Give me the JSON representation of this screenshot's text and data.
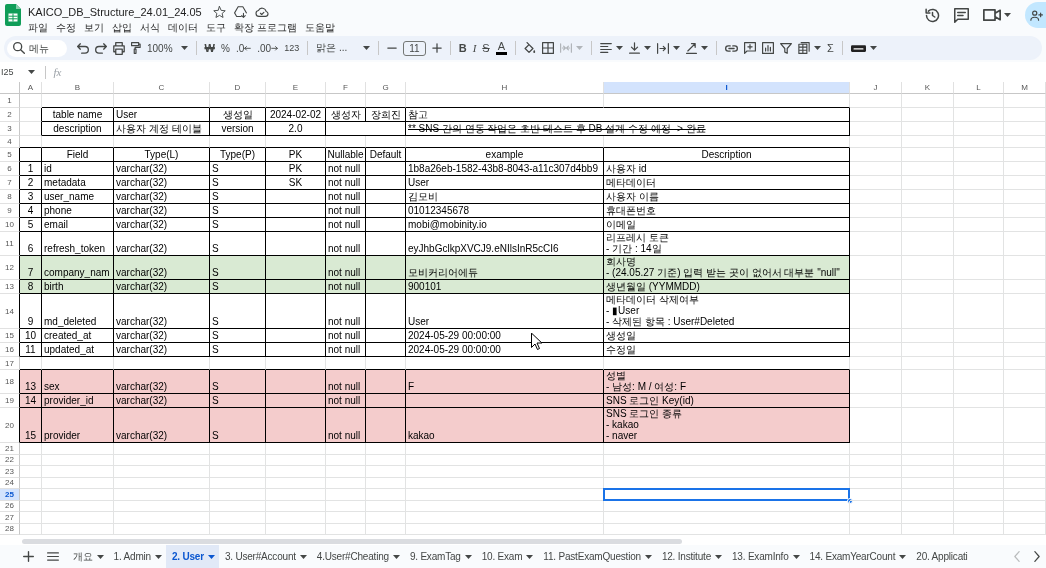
{
  "document": {
    "title": "KAICO_DB_Structure_24.01_24.05"
  },
  "menu_bar": [
    "파일",
    "수정",
    "보기",
    "삽입",
    "서식",
    "데이터",
    "도구",
    "확장 프로그램",
    "도움말"
  ],
  "toolbar": {
    "search": {
      "placeholder": "메뉴"
    },
    "zoom": "100%",
    "currency": "₩",
    "percent": "%",
    "decrease_decimal": ".0",
    "increase_decimal": ".00",
    "number_format": "123",
    "font": "맑은 ...",
    "font_size": "11",
    "bold": "B",
    "italic": "I",
    "strikethrough": "S",
    "text_color": "A",
    "merge_cells": {
      "disabled": true
    },
    "functions": "Σ"
  },
  "formula_bar": {
    "name_box": "I25",
    "fx": "fx"
  },
  "column_headers": [
    {
      "label": "A",
      "selected": false
    },
    {
      "label": "B",
      "selected": false
    },
    {
      "label": "C",
      "selected": false
    },
    {
      "label": "D",
      "selected": false
    },
    {
      "label": "E",
      "selected": false
    },
    {
      "label": "F",
      "selected": false
    },
    {
      "label": "G",
      "selected": false
    },
    {
      "label": "H",
      "selected": false
    },
    {
      "label": "I",
      "selected": true
    },
    {
      "label": "J",
      "selected": false
    },
    {
      "label": "K",
      "selected": false
    },
    {
      "label": "L",
      "selected": false
    },
    {
      "label": "M",
      "selected": false
    }
  ],
  "row_headers": [
    {
      "label": "1",
      "selected": false
    },
    {
      "label": "2",
      "selected": false
    },
    {
      "label": "3",
      "selected": false
    },
    {
      "label": "4",
      "selected": false
    },
    {
      "label": "5",
      "selected": false
    },
    {
      "label": "6",
      "selected": false
    },
    {
      "label": "7",
      "selected": false
    },
    {
      "label": "8",
      "selected": false
    },
    {
      "label": "9",
      "selected": false
    },
    {
      "label": "10",
      "selected": false
    },
    {
      "label": "11",
      "selected": false
    },
    {
      "label": "12",
      "selected": false
    },
    {
      "label": "13",
      "selected": false
    },
    {
      "label": "14",
      "selected": false
    },
    {
      "label": "15",
      "selected": false
    },
    {
      "label": "16",
      "selected": false
    },
    {
      "label": "17",
      "selected": false
    },
    {
      "label": "18",
      "selected": false
    },
    {
      "label": "19",
      "selected": false
    },
    {
      "label": "20",
      "selected": false
    },
    {
      "label": "21",
      "selected": false
    },
    {
      "label": "22",
      "selected": false
    },
    {
      "label": "23",
      "selected": false
    },
    {
      "label": "24",
      "selected": false
    },
    {
      "label": "25",
      "selected": true
    },
    {
      "label": "26",
      "selected": false
    },
    {
      "label": "27",
      "selected": false
    },
    {
      "label": "28",
      "selected": false
    }
  ],
  "info_table": {
    "table_name_label": "table name",
    "table_name": "User",
    "created_label": "생성일",
    "created_date": "2024-02-02",
    "author_label": "생성자",
    "author": "장희진",
    "note_label": "참고",
    "description_label": "description",
    "description": "사용자 계정 테이블",
    "version_label": "version",
    "version": "2.0",
    "note": "** SNS 간의 연동 작업은 초반 테스트 후 DB 설계 수정 예정 -> 완료",
    "note_struck_through": true
  },
  "fields_table": {
    "columns": [
      "Field",
      "Type(L)",
      "Type(P)",
      "PK",
      "Nullable",
      "Default",
      "example",
      "Description"
    ],
    "groups": [
      {
        "rows": [
          {
            "no": "1",
            "field": "id",
            "type_l": "varchar(32)",
            "type_p": "S",
            "pk": "PK",
            "nullable": "not null",
            "example": "1b8a26eb-1582-43b8-8043-a11c307d4bb9",
            "description": "사용자 id"
          },
          {
            "no": "2",
            "field": "metadata",
            "type_l": "varchar(32)",
            "type_p": "S",
            "pk": "SK",
            "nullable": "not null",
            "example": "User",
            "description": "메타데이터"
          },
          {
            "no": "3",
            "field": "user_name",
            "type_l": "varchar(32)",
            "type_p": "S",
            "nullable": "not null",
            "example": "김모비",
            "description": "사용자 이름"
          },
          {
            "no": "4",
            "field": "phone",
            "type_l": "varchar(32)",
            "type_p": "S",
            "nullable": "not null",
            "example": "01012345678",
            "description": "휴대폰번호"
          },
          {
            "no": "5",
            "field": "email",
            "type_l": "varchar(32)",
            "type_p": "S",
            "nullable": "not null",
            "example": "mobi@mobinity.io",
            "description": "이메일"
          },
          {
            "no": "6",
            "field": "refresh_token",
            "type_l": "varchar(32)",
            "type_p": "S",
            "nullable": "not null",
            "example": "eyJhbGclkpXVCJ9.eNIlsInR5cCI6",
            "description": "리프레시 토큰\n- 기간 : 14일"
          },
          {
            "no": "7",
            "field": "company_nam",
            "type_l": "varchar(32)",
            "type_p": "S",
            "nullable": "not null",
            "example": "모비커리어에듀",
            "description": "회사명\n- (24.05.27 기준) 입력 받는 곳이 없어서 대부분 \"null\"",
            "color": "#d9ead3"
          },
          {
            "no": "8",
            "field": "birth",
            "type_l": "varchar(32)",
            "type_p": "S",
            "nullable": "not null",
            "example": "900101",
            "description": "생년월일 (YYMMDD)",
            "color": "#d9ead3"
          },
          {
            "no": "9",
            "field": "md_deleted",
            "type_l": "varchar(32)",
            "type_p": "S",
            "nullable": "not null",
            "example": "User",
            "description": "메타데이터 삭제여부\n- ▮User\n- 삭제된 항목 : User#Deleted"
          },
          {
            "no": "10",
            "field": "created_at",
            "type_l": "varchar(32)",
            "type_p": "S",
            "nullable": "not null",
            "example": "2024-05-29 00:00:00",
            "description": "생성일"
          },
          {
            "no": "11",
            "field": "updated_at",
            "type_l": "varchar(32)",
            "type_p": "S",
            "nullable": "not null",
            "example": "2024-05-29 00:00:00",
            "description": "수정일"
          }
        ]
      },
      {
        "rows": [
          {
            "no": "13",
            "field": "sex",
            "type_l": "varchar(32)",
            "type_p": "S",
            "nullable": "not null",
            "example": "F",
            "description": "성별\n- 남성: M / 여성: F",
            "color": "#f4cccc"
          },
          {
            "no": "14",
            "field": "provider_id",
            "type_l": "varchar(32)",
            "type_p": "S",
            "nullable": "not null",
            "description": "SNS 로그인 Key(id)",
            "color": "#f4cccc"
          },
          {
            "no": "15",
            "field": "provider",
            "type_l": "varchar(32)",
            "type_p": "S",
            "nullable": "not null",
            "example": "kakao",
            "description": "SNS 로그인 종류\n- kakao\n- naver",
            "color": "#f4cccc"
          }
        ]
      }
    ]
  },
  "sheet_tabs": [
    {
      "label": "개요",
      "selected": false
    },
    {
      "label": "1. Admin",
      "selected": false
    },
    {
      "label": "2. User",
      "selected": true
    },
    {
      "label": "3. User#Account",
      "selected": false
    },
    {
      "label": "4.User#Cheating",
      "selected": false
    },
    {
      "label": "9. ExamTag",
      "selected": false
    },
    {
      "label": "10. Exam",
      "selected": false
    },
    {
      "label": "11. PastExamQuestion",
      "selected": false
    },
    {
      "label": "12. Institute",
      "selected": false
    },
    {
      "label": "13. ExamInfo",
      "selected": false
    },
    {
      "label": "14. ExamYearCount",
      "selected": false
    },
    {
      "label": "20. Applicati",
      "selected": false
    }
  ]
}
